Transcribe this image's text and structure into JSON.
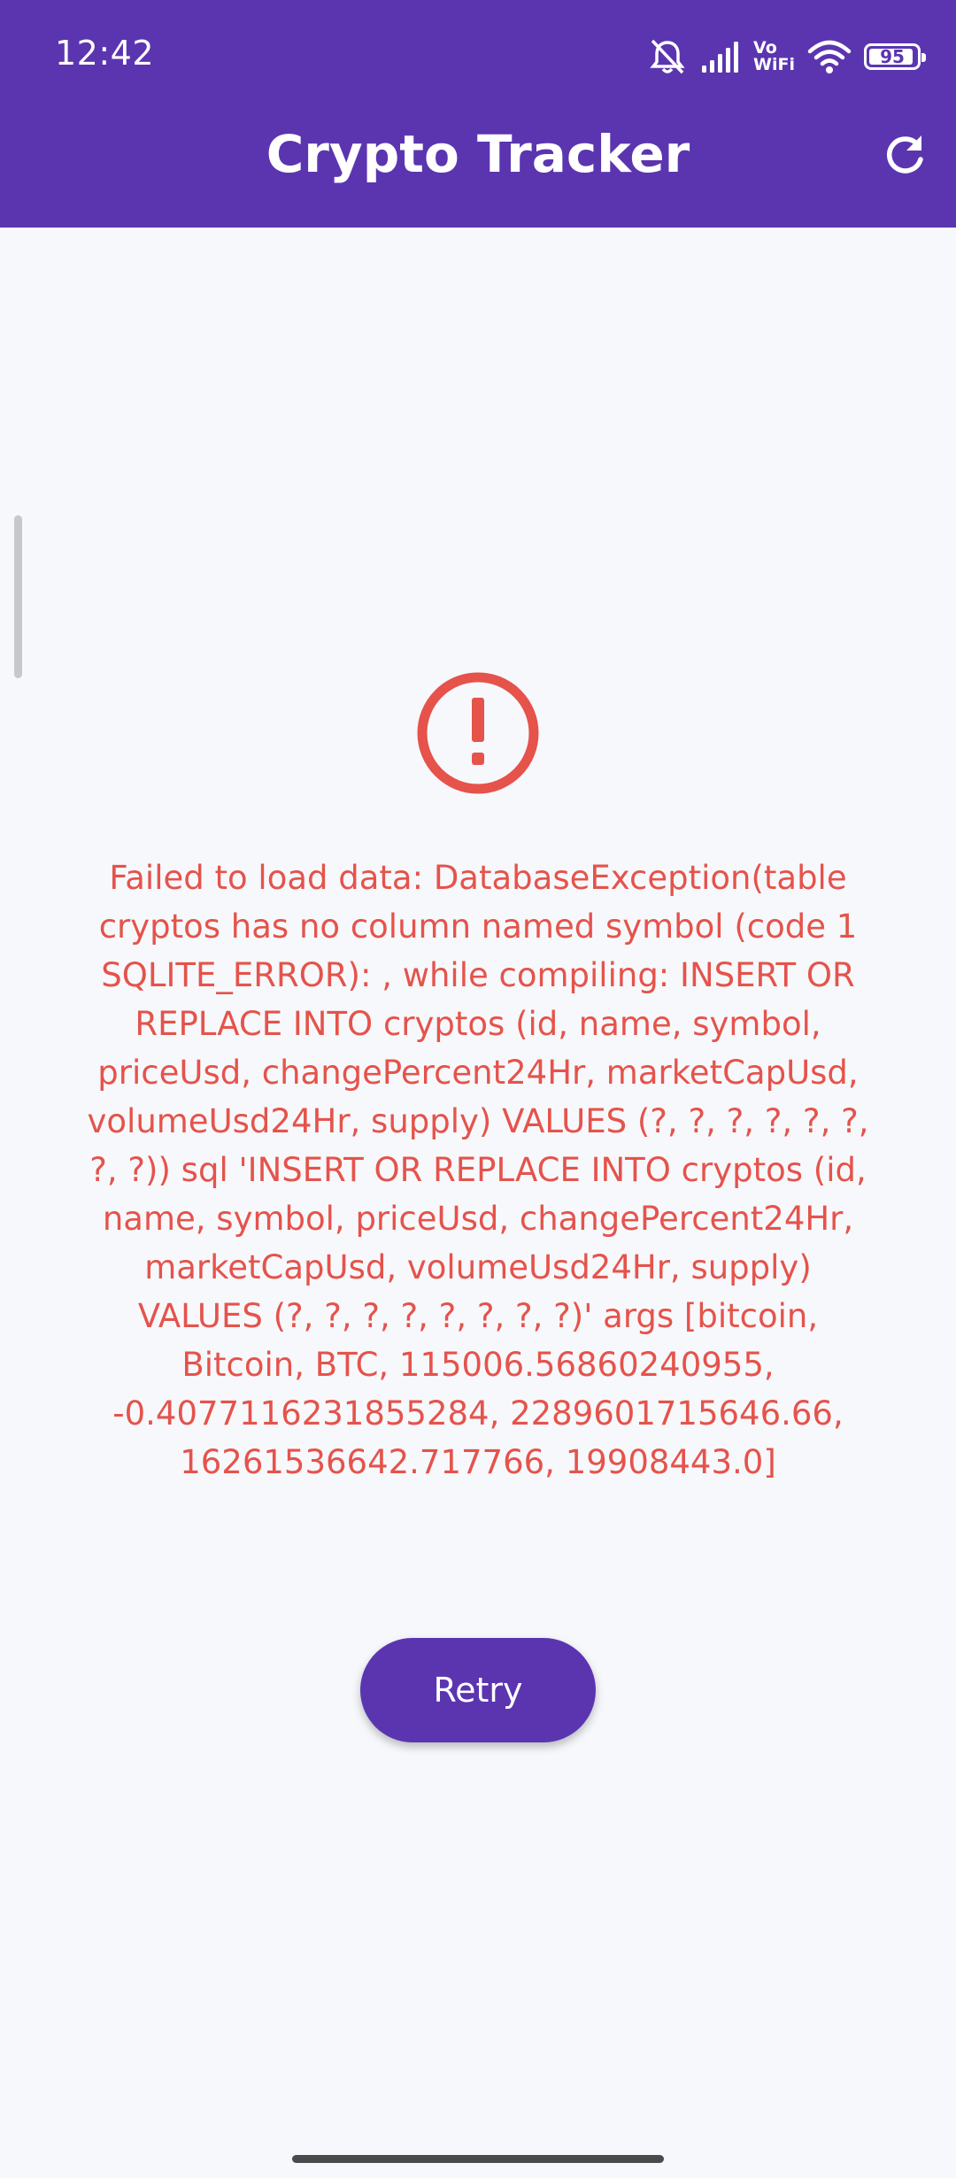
{
  "status_bar": {
    "time": "12:42",
    "vo_label": "Vo",
    "wifi_label": "WiFi",
    "battery_level": "95",
    "battery_fraction": 0.95,
    "icons": [
      "muted-icon",
      "signal-icon",
      "vowifi-icon",
      "wifi-icon",
      "battery-icon"
    ]
  },
  "app_bar": {
    "title": "Crypto Tracker",
    "refresh_icon": "refresh-icon"
  },
  "error": {
    "icon": "error-circle-icon",
    "message": "Failed to load data: DatabaseException(table cryptos has no column named symbol (code 1 SQLITE_ERROR): , while compiling: INSERT OR REPLACE INTO cryptos (id, name, symbol, priceUsd, changePercent24Hr, marketCapUsd, volumeUsd24Hr, supply) VALUES (?, ?, ?, ?, ?, ?, ?, ?)) sql 'INSERT OR REPLACE INTO cryptos (id, name, symbol, priceUsd, changePercent24Hr, marketCapUsd, volumeUsd24Hr, supply) VALUES (?, ?, ?, ?, ?, ?, ?, ?)' args [bitcoin, Bitcoin, BTC, 115006.56860240955, -0.4077116231855284, 2289601715646.66, 16261536642.717766, 19908443.0]"
  },
  "retry_button": {
    "label": "Retry"
  },
  "colors": {
    "primary": "#5b35b0",
    "error": "#e5534b",
    "background": "#f7f8fc"
  }
}
